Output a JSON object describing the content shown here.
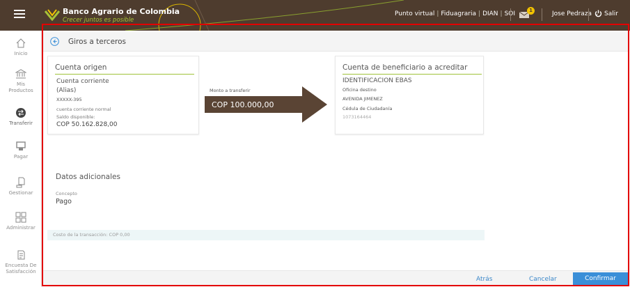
{
  "topbar": {
    "brand": "Banco Agrario de Colombia",
    "slogan": "Crecer juntos es posible",
    "links": [
      "Punto virtual",
      "Fiduagraria",
      "DIAN",
      "SOI"
    ],
    "notification_count": "1",
    "user_name": "Jose Pedraza",
    "logout_label": "Salir",
    "colors": {
      "bar": "#4e3c2e",
      "accent_green": "#a7c238",
      "badge": "#f3c300"
    }
  },
  "sidebar": {
    "items": [
      {
        "label": "Inicio",
        "icon": "home-icon"
      },
      {
        "label": "Mis Productos",
        "icon": "bank-icon"
      },
      {
        "label": "Transferir",
        "icon": "transfer-icon",
        "active": true
      },
      {
        "label": "Pagar",
        "icon": "pay-icon"
      },
      {
        "label": "Gestionar",
        "icon": "manage-icon"
      },
      {
        "label": "Administrar",
        "icon": "grid-icon"
      },
      {
        "label": "Encuesta De Satisfacción",
        "icon": "survey-icon"
      }
    ]
  },
  "page": {
    "title": "Giros a terceros"
  },
  "origin": {
    "title": "Cuenta origen",
    "account_type": "Cuenta corriente",
    "alias": "(Alias)",
    "account_number": "XXXXX-395",
    "description": "cuenta corriente normal",
    "balance_label": "Saldo disponible:",
    "balance_value": "COP 50.162.828,00"
  },
  "transfer": {
    "amount_label": "Monto a transferir",
    "amount_value": "COP 100.000,00"
  },
  "beneficiary": {
    "title": "Cuenta de beneficiario a acreditar",
    "name": "IDENTIFICACION EBAS",
    "office_label": "Oficina destino",
    "office_value": "AVENIDA JIMENEZ",
    "doc_type": "Cédula de Ciudadanía",
    "doc_number": "1073164464"
  },
  "additional": {
    "title": "Datos adicionales",
    "concept_label": "Concepto",
    "concept_value": "Pago"
  },
  "cost": {
    "text": "Costo de la transacción: COP 0,00"
  },
  "footer": {
    "back_label": "Atrás",
    "cancel_label": "Cancelar",
    "confirm_label": "Confirmar"
  }
}
